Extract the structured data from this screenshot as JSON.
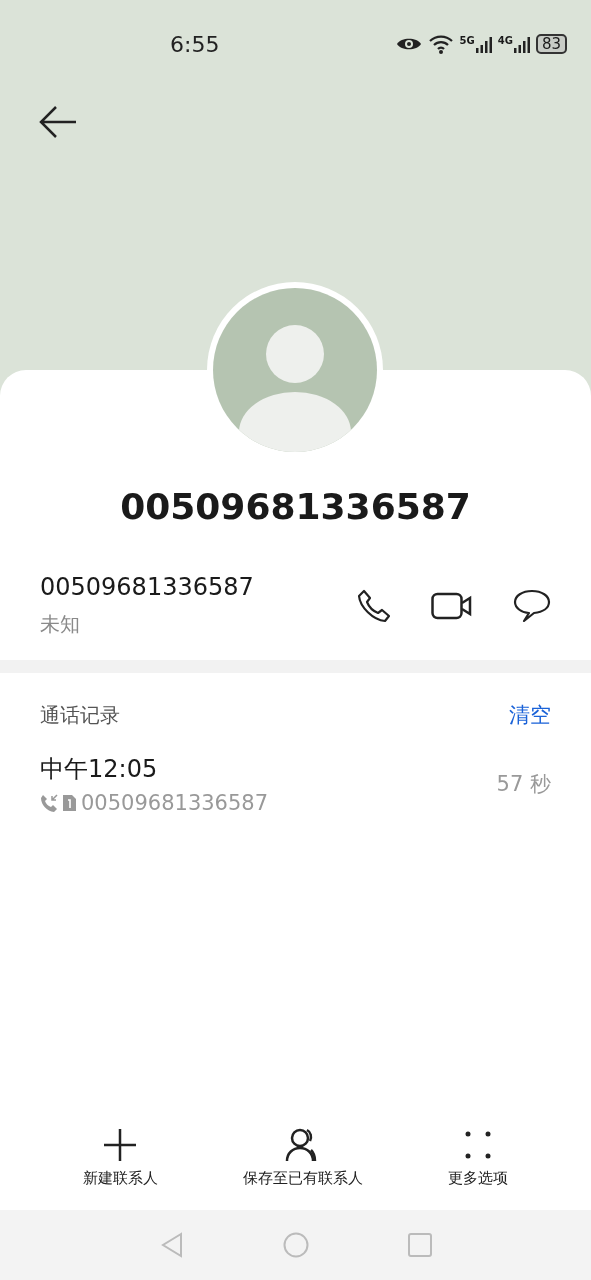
{
  "status_bar": {
    "time": "6:55",
    "network_5g": "5G",
    "network_4g": "4G",
    "battery": "83"
  },
  "contact": {
    "title": "00509681336587",
    "number": "00509681336587",
    "location": "未知"
  },
  "call_log": {
    "heading": "通话记录",
    "clear": "清空",
    "entries": [
      {
        "time": "中午12:05",
        "number": "00509681336587",
        "duration": "57 秒"
      }
    ]
  },
  "actions": [
    {
      "kind": "add",
      "label": "新建联系人"
    },
    {
      "kind": "person",
      "label": "保存至已有联系人"
    },
    {
      "kind": "more",
      "label": "更多选项"
    }
  ]
}
